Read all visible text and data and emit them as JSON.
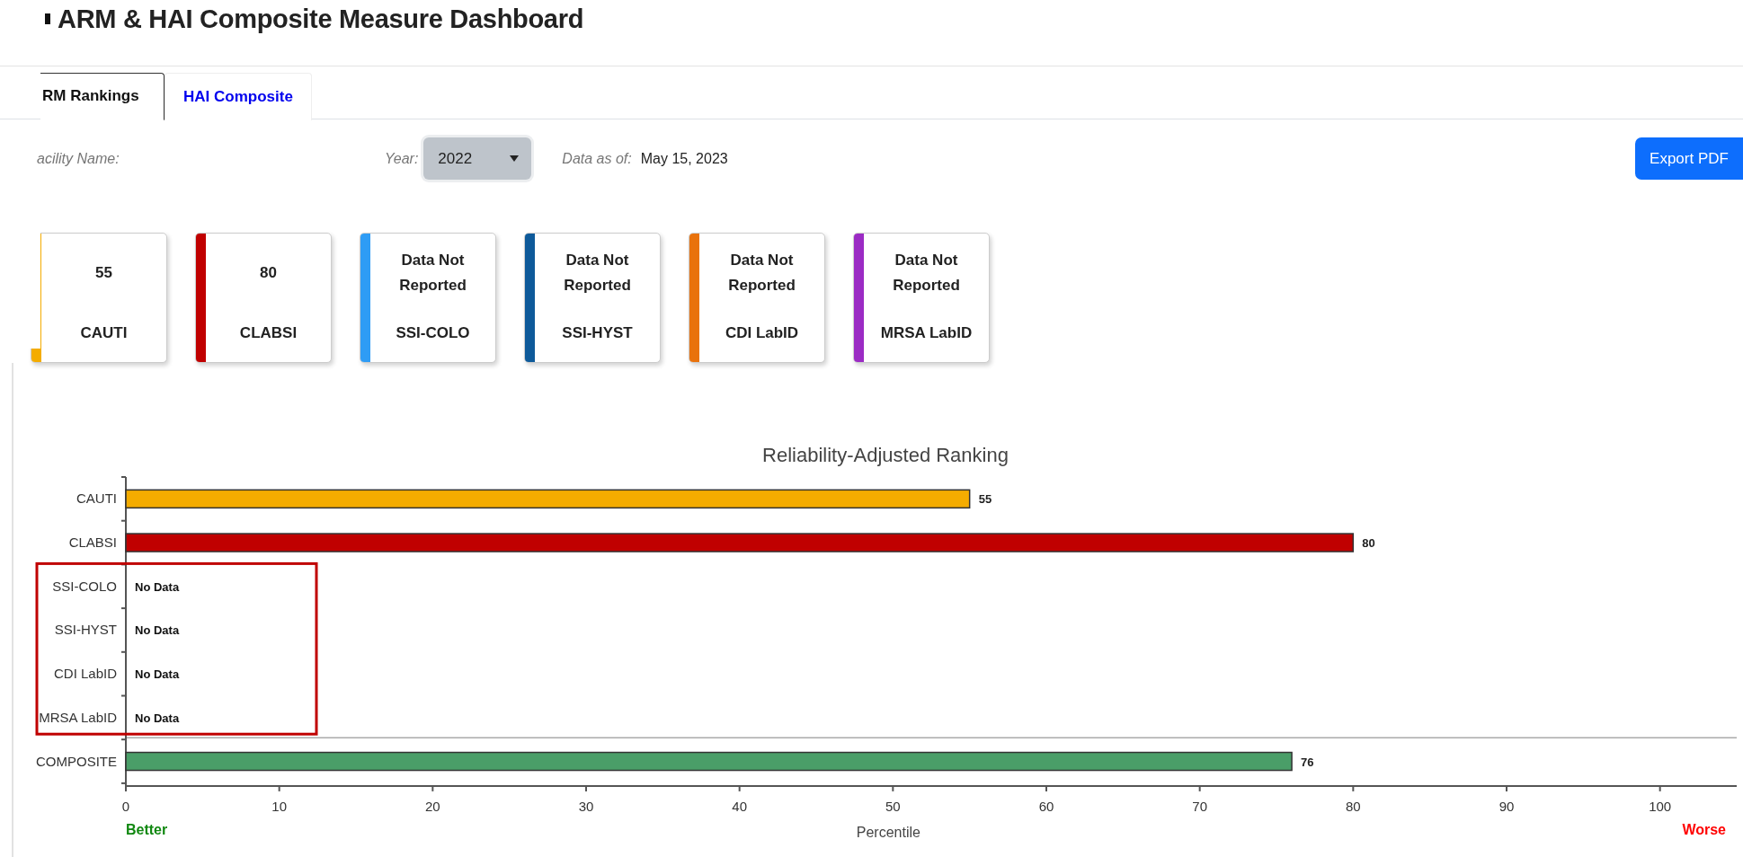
{
  "page_title": "ARM & HAI Composite Measure Dashboard",
  "tabs": [
    {
      "label": "RM Rankings",
      "selected": true
    },
    {
      "label": "HAI Composite",
      "selected": false
    }
  ],
  "filters": {
    "facility_label": "acility Name:",
    "year_label": "Year:",
    "year_value": "2022",
    "data_as_of_label": "Data as of:",
    "data_as_of_value": "May 15, 2023"
  },
  "export_button": "Export PDF",
  "cards": [
    {
      "value": "55",
      "label": "CAUTI",
      "color": "#f4ac00"
    },
    {
      "value": "80",
      "label": "CLABSI",
      "color": "#c00000"
    },
    {
      "value": "Data Not Reported",
      "label": "SSI-COLO",
      "color": "#2e9cf5"
    },
    {
      "value": "Data Not Reported",
      "label": "SSI-HYST",
      "color": "#0e5a9a"
    },
    {
      "value": "Data Not Reported",
      "label": "CDI LabID",
      "color": "#e9720c"
    },
    {
      "value": "Data Not Reported",
      "label": "MRSA LabID",
      "color": "#9b2bc4"
    }
  ],
  "chart": {
    "better_label": "Better",
    "worse_label": "Worse",
    "chart_data": {
      "type": "bar",
      "orientation": "horizontal",
      "title": "Reliability-Adjusted Ranking",
      "xlabel": "Percentile",
      "categories": [
        "CAUTI",
        "CLABSI",
        "SSI-COLO",
        "SSI-HYST",
        "CDI LabID",
        "MRSA LabID",
        "COMPOSITE"
      ],
      "values": [
        55,
        80,
        null,
        null,
        null,
        null,
        76
      ],
      "value_labels": [
        "55",
        "80",
        "No Data",
        "No Data",
        "No Data",
        "No Data",
        "76"
      ],
      "xlim": [
        0,
        105
      ],
      "xticks": [
        0,
        10,
        20,
        30,
        40,
        50,
        60,
        70,
        80,
        90,
        100
      ]
    }
  }
}
